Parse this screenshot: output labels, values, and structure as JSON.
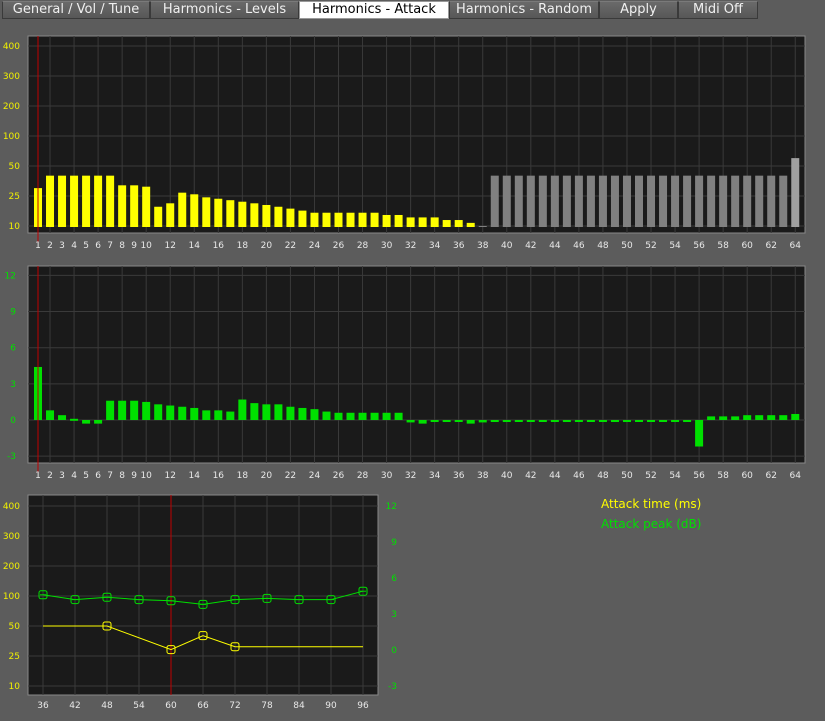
{
  "tabs": [
    {
      "label": "General / Vol / Tune",
      "active": false
    },
    {
      "label": "Harmonics - Levels",
      "active": false
    },
    {
      "label": "Harmonics - Attack",
      "active": true
    },
    {
      "label": "Harmonics - Random",
      "active": false
    },
    {
      "label": "Apply",
      "active": false
    },
    {
      "label": "Midi Off",
      "active": false
    }
  ],
  "legend": {
    "attack_time": "Attack time (ms)",
    "attack_peak": "Attack peak (dB)"
  },
  "colors": {
    "yellow": "#ffff00",
    "grey": "#808080",
    "green": "#00e000",
    "cursor": "#c00000",
    "plot_bg": "#1a1a1a"
  },
  "chart_data": [
    {
      "type": "bar",
      "name_hint": "attack time per harmonic",
      "yscale": "log",
      "yticks": [
        10,
        25,
        50,
        100,
        200,
        300,
        400
      ],
      "ylim": [
        8,
        450
      ],
      "x": [
        1,
        2,
        3,
        4,
        5,
        6,
        7,
        8,
        9,
        10,
        11,
        12,
        13,
        14,
        15,
        16,
        17,
        18,
        19,
        20,
        21,
        22,
        23,
        24,
        25,
        26,
        27,
        28,
        29,
        30,
        31,
        32,
        33,
        34,
        35,
        36,
        37,
        38,
        39,
        40,
        41,
        42,
        43,
        44,
        45,
        46,
        47,
        48,
        49,
        50,
        51,
        52,
        53,
        54,
        55,
        56,
        57,
        58,
        59,
        60,
        61,
        62,
        63,
        64
      ],
      "xticks": [
        "1",
        "2",
        "3",
        "4",
        "5",
        "6",
        "7",
        "8",
        "9",
        "10",
        "12",
        "14",
        "16",
        "18",
        "20",
        "22",
        "24",
        "26",
        "28",
        "30",
        "32",
        "34",
        "36",
        "38",
        "40",
        "42",
        "44",
        "46",
        "48",
        "50",
        "52",
        "54",
        "56",
        "58",
        "60",
        "62",
        "64"
      ],
      "values": [
        30,
        40,
        40,
        40,
        40,
        40,
        40,
        32,
        32,
        31,
        18,
        20,
        27,
        26,
        24,
        23,
        22,
        21,
        20,
        19,
        18,
        17,
        16,
        15,
        15,
        15,
        15,
        15,
        15,
        14,
        14,
        13,
        13,
        13,
        12,
        12,
        11,
        10,
        40,
        40,
        40,
        40,
        40,
        40,
        40,
        40,
        40,
        40,
        40,
        40,
        40,
        40,
        40,
        40,
        40,
        40,
        40,
        40,
        40,
        40,
        40,
        40,
        40,
        60
      ],
      "active_count": 37,
      "cursor_x": 1
    },
    {
      "type": "bar",
      "name_hint": "attack peak per harmonic",
      "yticks": [
        12,
        9,
        6,
        3,
        0,
        -3
      ],
      "ylim": [
        -4,
        13
      ],
      "x": [
        1,
        2,
        3,
        4,
        5,
        6,
        7,
        8,
        9,
        10,
        11,
        12,
        13,
        14,
        15,
        16,
        17,
        18,
        19,
        20,
        21,
        22,
        23,
        24,
        25,
        26,
        27,
        28,
        29,
        30,
        31,
        32,
        33,
        34,
        35,
        36,
        37,
        38,
        39,
        40,
        41,
        42,
        43,
        44,
        45,
        46,
        47,
        48,
        49,
        50,
        51,
        52,
        53,
        54,
        55,
        56,
        57,
        58,
        59,
        60,
        61,
        62,
        63,
        64
      ],
      "xticks": [
        "1",
        "2",
        "3",
        "4",
        "5",
        "6",
        "7",
        "8",
        "9",
        "10",
        "12",
        "14",
        "16",
        "18",
        "20",
        "22",
        "24",
        "26",
        "28",
        "30",
        "32",
        "34",
        "36",
        "38",
        "40",
        "42",
        "44",
        "46",
        "48",
        "50",
        "52",
        "54",
        "56",
        "58",
        "60",
        "62",
        "64"
      ],
      "values": [
        4.4,
        0.8,
        0.4,
        0.1,
        -0.3,
        -0.3,
        1.6,
        1.6,
        1.6,
        1.5,
        1.3,
        1.2,
        1.1,
        1.0,
        0.8,
        0.8,
        0.7,
        1.7,
        1.4,
        1.3,
        1.3,
        1.1,
        1.0,
        0.9,
        0.7,
        0.6,
        0.6,
        0.6,
        0.6,
        0.6,
        0.6,
        -0.2,
        -0.3,
        -0.1,
        -0.1,
        -0.1,
        -0.3,
        -0.2,
        -0.1,
        -0.1,
        -0.1,
        -0.1,
        -0.1,
        -0.1,
        -0.1,
        -0.1,
        -0.1,
        -0.1,
        -0.1,
        -0.1,
        -0.1,
        -0.1,
        -0.1,
        -0.1,
        -0.1,
        -2.2,
        0.3,
        0.3,
        0.3,
        0.4,
        0.4,
        0.4,
        0.4,
        0.5
      ],
      "cursor_x": 1
    },
    {
      "type": "line",
      "name_hint": "attack envelope vs key",
      "x": [
        36,
        42,
        48,
        54,
        60,
        66,
        72,
        78,
        84,
        90,
        96
      ],
      "xticks": [
        "36",
        "42",
        "48",
        "54",
        "60",
        "66",
        "72",
        "78",
        "84",
        "90",
        "96"
      ],
      "yticks_left": [
        10,
        25,
        50,
        100,
        200,
        300,
        400
      ],
      "yticks_right": [
        12,
        9,
        6,
        3,
        0,
        -3
      ],
      "cursor_x": 60,
      "series": [
        {
          "name": "Attack time (ms)",
          "color": "#ffff00",
          "x": [
            36,
            48,
            60,
            66,
            72,
            96
          ],
          "y": [
            50,
            50,
            29,
            40,
            31,
            31
          ],
          "markers": [
            48,
            60,
            66,
            72
          ]
        },
        {
          "name": "Attack peak (dB)",
          "color": "#00e000",
          "x": [
            36,
            42,
            48,
            54,
            60,
            66,
            72,
            78,
            84,
            90,
            96
          ],
          "y": [
            4.6,
            4.2,
            4.4,
            4.2,
            4.1,
            3.8,
            4.2,
            4.3,
            4.2,
            4.2,
            4.9
          ]
        }
      ]
    }
  ]
}
